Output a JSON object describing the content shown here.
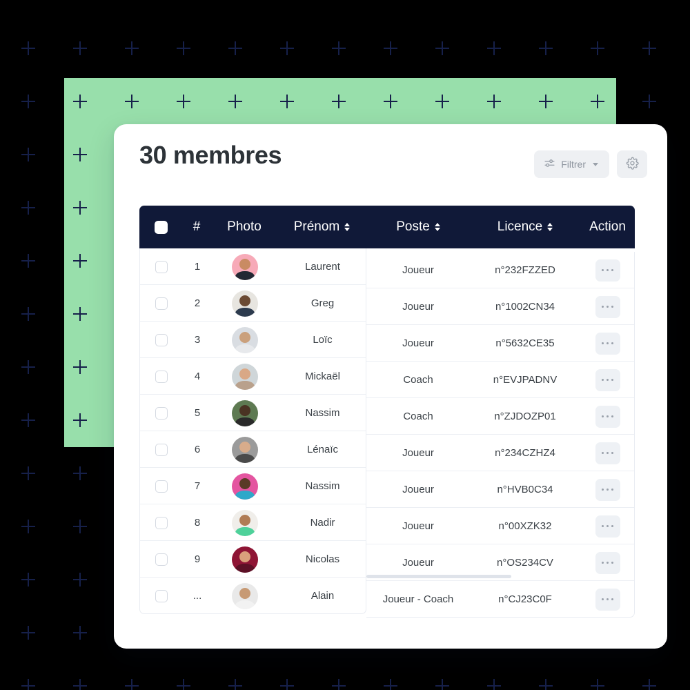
{
  "background": {
    "page_color": "#000000",
    "panel_color": "#98dfab",
    "plus_color": "#16204a",
    "plus_glyph": "+"
  },
  "card": {
    "title": "30 membres",
    "surface_color": "#ffffff"
  },
  "toolbar": {
    "filter_label": "Filtrer",
    "filter_icon": "sliders-icon",
    "filter_caret_icon": "chevron-down-icon",
    "settings_icon": "gear-icon",
    "button_bg": "#eef0f3"
  },
  "table": {
    "header_bg": "#101938",
    "header_text_color": "#ffffff",
    "sort_icon": "sort-updown-icon",
    "action_icon": "ellipsis-icon",
    "columns": [
      {
        "key": "select",
        "label": "",
        "sortable": false
      },
      {
        "key": "index",
        "label": "#",
        "sortable": false
      },
      {
        "key": "photo",
        "label": "Photo",
        "sortable": false
      },
      {
        "key": "prenom",
        "label": "Prénom",
        "sortable": true
      },
      {
        "key": "poste",
        "label": "Poste",
        "sortable": true
      },
      {
        "key": "licence",
        "label": "Licence",
        "sortable": true
      },
      {
        "key": "action",
        "label": "Action",
        "sortable": false
      }
    ],
    "rows": [
      {
        "index": "1",
        "prenom": "Laurent",
        "poste": "Joueur",
        "licence": "n°232FZZED",
        "avatar_bg": "#f7aab8",
        "avatar_skin": "#c98b63",
        "avatar_body": "#232833"
      },
      {
        "index": "2",
        "prenom": "Greg",
        "poste": "Joueur",
        "licence": "n°1002CN34",
        "avatar_bg": "#e7e5e0",
        "avatar_skin": "#6b4a33",
        "avatar_body": "#2c3a4d"
      },
      {
        "index": "3",
        "prenom": "Loïc",
        "poste": "Joueur",
        "licence": "n°5632CE35",
        "avatar_bg": "#d9dde2",
        "avatar_skin": "#caa07c",
        "avatar_body": "#e7e9ec"
      },
      {
        "index": "4",
        "prenom": "Mickaël",
        "poste": "Coach",
        "licence": "n°EVJPADNV",
        "avatar_bg": "#cfd6d9",
        "avatar_skin": "#d9a886",
        "avatar_body": "#b9a18c"
      },
      {
        "index": "5",
        "prenom": "Nassim",
        "poste": "Coach",
        "licence": "n°ZJDOZP01",
        "avatar_bg": "#5e7a52",
        "avatar_skin": "#4a3323",
        "avatar_body": "#2a2a2a"
      },
      {
        "index": "6",
        "prenom": "Lénaïc",
        "poste": "Joueur",
        "licence": "n°234CZHZ4",
        "avatar_bg": "#9b9b9b",
        "avatar_skin": "#d8ac8b",
        "avatar_body": "#4a4a4a"
      },
      {
        "index": "7",
        "prenom": "Nassim",
        "poste": "Joueur",
        "licence": "n°HVB0C34",
        "avatar_bg": "#e455a0",
        "avatar_skin": "#5a3a26",
        "avatar_body": "#2fa8c9"
      },
      {
        "index": "8",
        "prenom": "Nadir",
        "poste": "Joueur",
        "licence": "n°00XZK32",
        "avatar_bg": "#f0eeea",
        "avatar_skin": "#b07c55",
        "avatar_body": "#4ed19a"
      },
      {
        "index": "9",
        "prenom": "Nicolas",
        "poste": "Joueur",
        "licence": "n°OS234CV",
        "avatar_bg": "#8f1535",
        "avatar_skin": "#d9a07c",
        "avatar_body": "#5c1026"
      },
      {
        "index": "...",
        "prenom": "Alain",
        "poste": "Joueur - Coach",
        "licence": "n°CJ23C0F",
        "avatar_bg": "#e9e9e9",
        "avatar_skin": "#c79a74",
        "avatar_body": "#f2f2f2"
      }
    ]
  }
}
